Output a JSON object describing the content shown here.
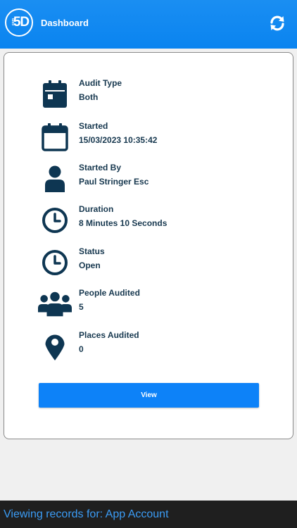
{
  "header": {
    "logo_small": "com",
    "logo_big": "5D",
    "title": "Dashboard",
    "refresh_icon": "refresh-icon"
  },
  "colors": {
    "brand": "#0a84f0",
    "text_dark": "#17384f",
    "icon": "#0e3652",
    "button": "#0d82f8",
    "footer_bg": "#1f1f1f",
    "footer_text": "#3b9cf5"
  },
  "details": [
    {
      "icon": "calendar-event-icon",
      "label": "Audit Type",
      "value": "Both"
    },
    {
      "icon": "calendar-icon",
      "label": "Started",
      "value": "15/03/2023 10:35:42"
    },
    {
      "icon": "person-icon",
      "label": "Started By",
      "value": "Paul Stringer Esc"
    },
    {
      "icon": "clock-icon",
      "label": "Duration",
      "value": "8 Minutes 10 Seconds"
    },
    {
      "icon": "clock-icon",
      "label": "Status",
      "value": "Open"
    },
    {
      "icon": "people-icon",
      "label": "People Audited",
      "value": "5"
    },
    {
      "icon": "location-pin-icon",
      "label": "Places Audited",
      "value": "0"
    }
  ],
  "actions": {
    "view_label": "View"
  },
  "footer": {
    "text": "Viewing records for: App Account"
  }
}
